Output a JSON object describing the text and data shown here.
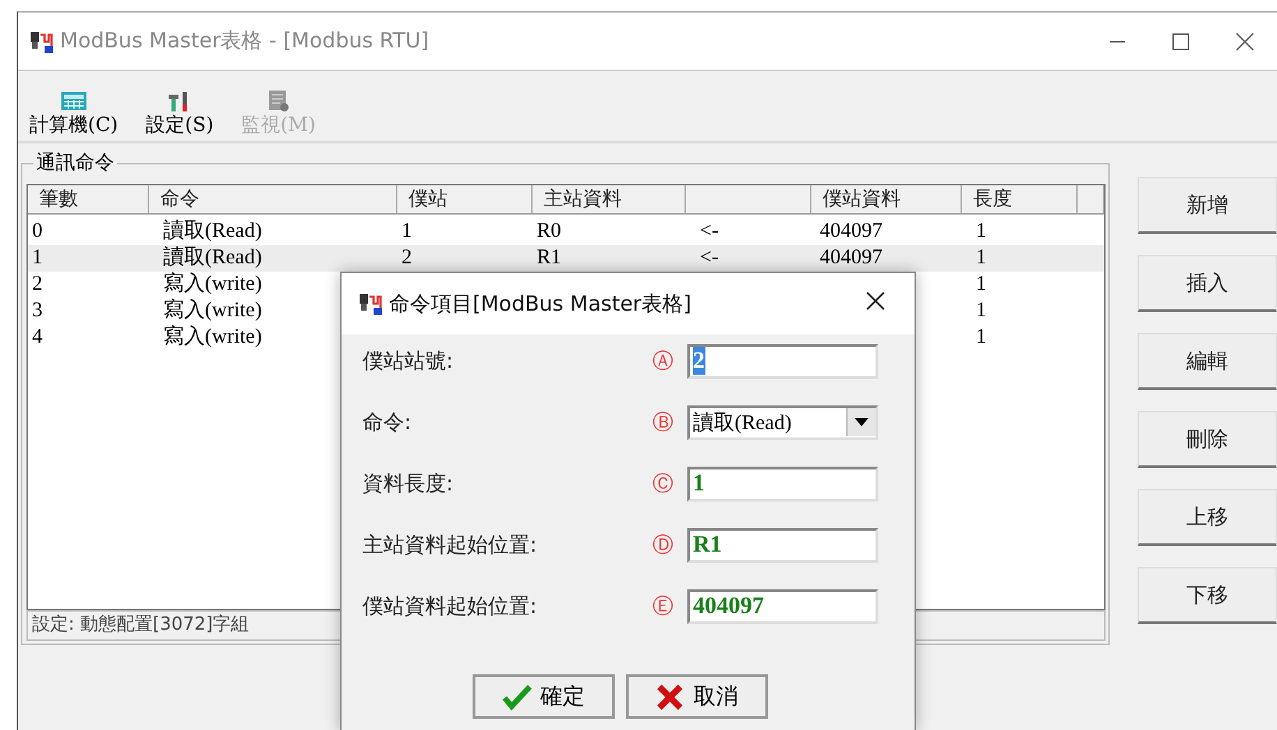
{
  "window": {
    "title": "ModBus Master表格 - [Modbus RTU]"
  },
  "toolbar": [
    {
      "label": "計算機(C)",
      "kind": "calculator",
      "disabled": false
    },
    {
      "label": "設定(S)",
      "kind": "tools",
      "disabled": false
    },
    {
      "label": "監視(M)",
      "kind": "monitor",
      "disabled": true
    }
  ],
  "group": {
    "title": "通訊命令"
  },
  "table": {
    "columns": [
      "筆數",
      "命令",
      "僕站",
      "主站資料",
      "",
      "僕站資料",
      "長度",
      ""
    ],
    "rows": [
      {
        "selected": false,
        "cells": [
          "0",
          "讀取(Read)",
          "1",
          "R0",
          "<-",
          "404097",
          "1"
        ]
      },
      {
        "selected": true,
        "cells": [
          "1",
          "讀取(Read)",
          "2",
          "R1",
          "<-",
          "404097",
          "1"
        ]
      },
      {
        "selected": false,
        "cells": [
          "2",
          "寫入(write)",
          null,
          null,
          null,
          null,
          "1"
        ]
      },
      {
        "selected": false,
        "cells": [
          "3",
          "寫入(write)",
          null,
          null,
          null,
          null,
          "1"
        ]
      },
      {
        "selected": false,
        "cells": [
          "4",
          "寫入(write)",
          null,
          null,
          null,
          null,
          "1"
        ]
      }
    ]
  },
  "status_bar": "設定: 動態配置[3072]字組",
  "side_buttons": [
    "新增",
    "插入",
    "編輯",
    "刪除",
    "上移",
    "下移"
  ],
  "dialog": {
    "title": "命令項目[ModBus Master表格]",
    "fields": [
      {
        "label": "僕站站號:",
        "marker": "Ⓐ",
        "kind": "text",
        "value": "2",
        "text_selected": true
      },
      {
        "label": "命令:",
        "marker": "Ⓑ",
        "kind": "dropdown",
        "value": "讀取(Read)"
      },
      {
        "label": "資料長度:",
        "marker": "Ⓒ",
        "kind": "text",
        "value": "1"
      },
      {
        "label": "主站資料起始位置:",
        "marker": "Ⓓ",
        "kind": "text",
        "value": "R1"
      },
      {
        "label": "僕站資料起始位置:",
        "marker": "Ⓔ",
        "kind": "text",
        "value": "404097"
      }
    ],
    "buttons": [
      {
        "label": "確定",
        "kind": "ok"
      },
      {
        "label": "取消",
        "kind": "cancel"
      }
    ]
  }
}
